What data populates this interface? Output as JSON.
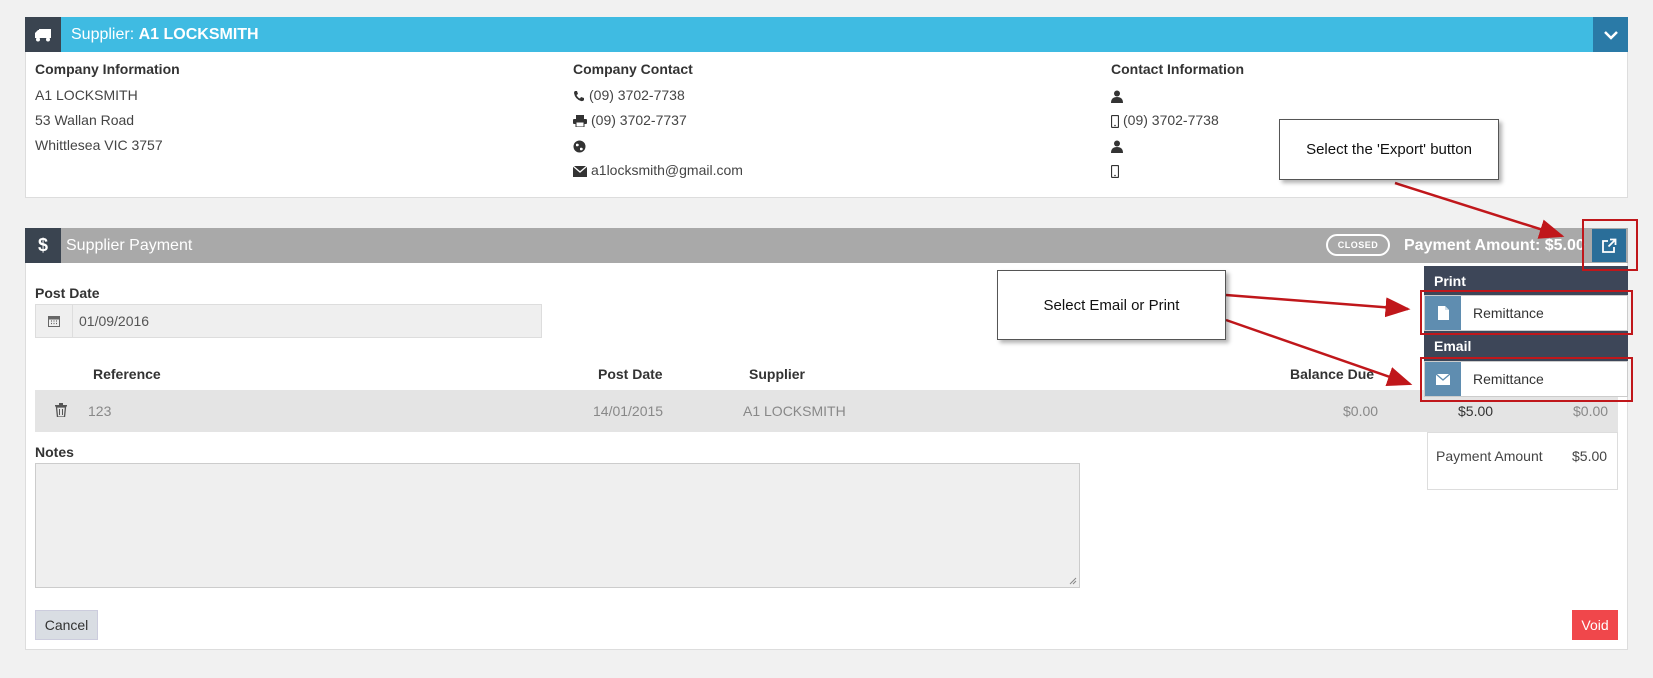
{
  "supplier": {
    "title_prefix": "Supplier: ",
    "title_name": "A1 LOCKSMITH",
    "company_info": {
      "heading": "Company Information",
      "name": "A1 LOCKSMITH",
      "street": "53 Wallan Road",
      "city": "Whittlesea VIC 3757"
    },
    "company_contact": {
      "heading": "Company Contact",
      "phone": "(09) 3702-7738",
      "fax": "(09) 3702-7737",
      "email": "a1locksmith@gmail.com"
    },
    "contact_info": {
      "heading": "Contact Information",
      "mobile": "(09) 3702-7738"
    }
  },
  "payment": {
    "title": "Supplier Payment",
    "status": "CLOSED",
    "amount_label": "Payment Amount: $5.00",
    "post_date_label": "Post Date",
    "post_date_value": "01/09/2016",
    "columns": [
      "Reference",
      "Post Date",
      "Supplier",
      "Balance Due"
    ],
    "row": {
      "reference": "123",
      "post_date": "14/01/2015",
      "supplier": "A1 LOCKSMITH",
      "balance_due": "$0.00",
      "paid": "$5.00",
      "remaining": "$0.00"
    },
    "notes_label": "Notes",
    "summary_label": "Payment Amount",
    "summary_value": "$5.00",
    "cancel_label": "Cancel",
    "void_label": "Void"
  },
  "export_menu": {
    "print_heading": "Print",
    "print_item": "Remittance",
    "email_heading": "Email",
    "email_item": "Remittance"
  },
  "callouts": {
    "export": "Select the 'Export' button",
    "email_print": "Select Email or Print"
  },
  "colors": {
    "supplier_header": "#3fbbe2",
    "payment_header": "#a9a9a9",
    "dark": "#3a4450",
    "void": "#f0474b",
    "highlight": "#c0171b"
  }
}
